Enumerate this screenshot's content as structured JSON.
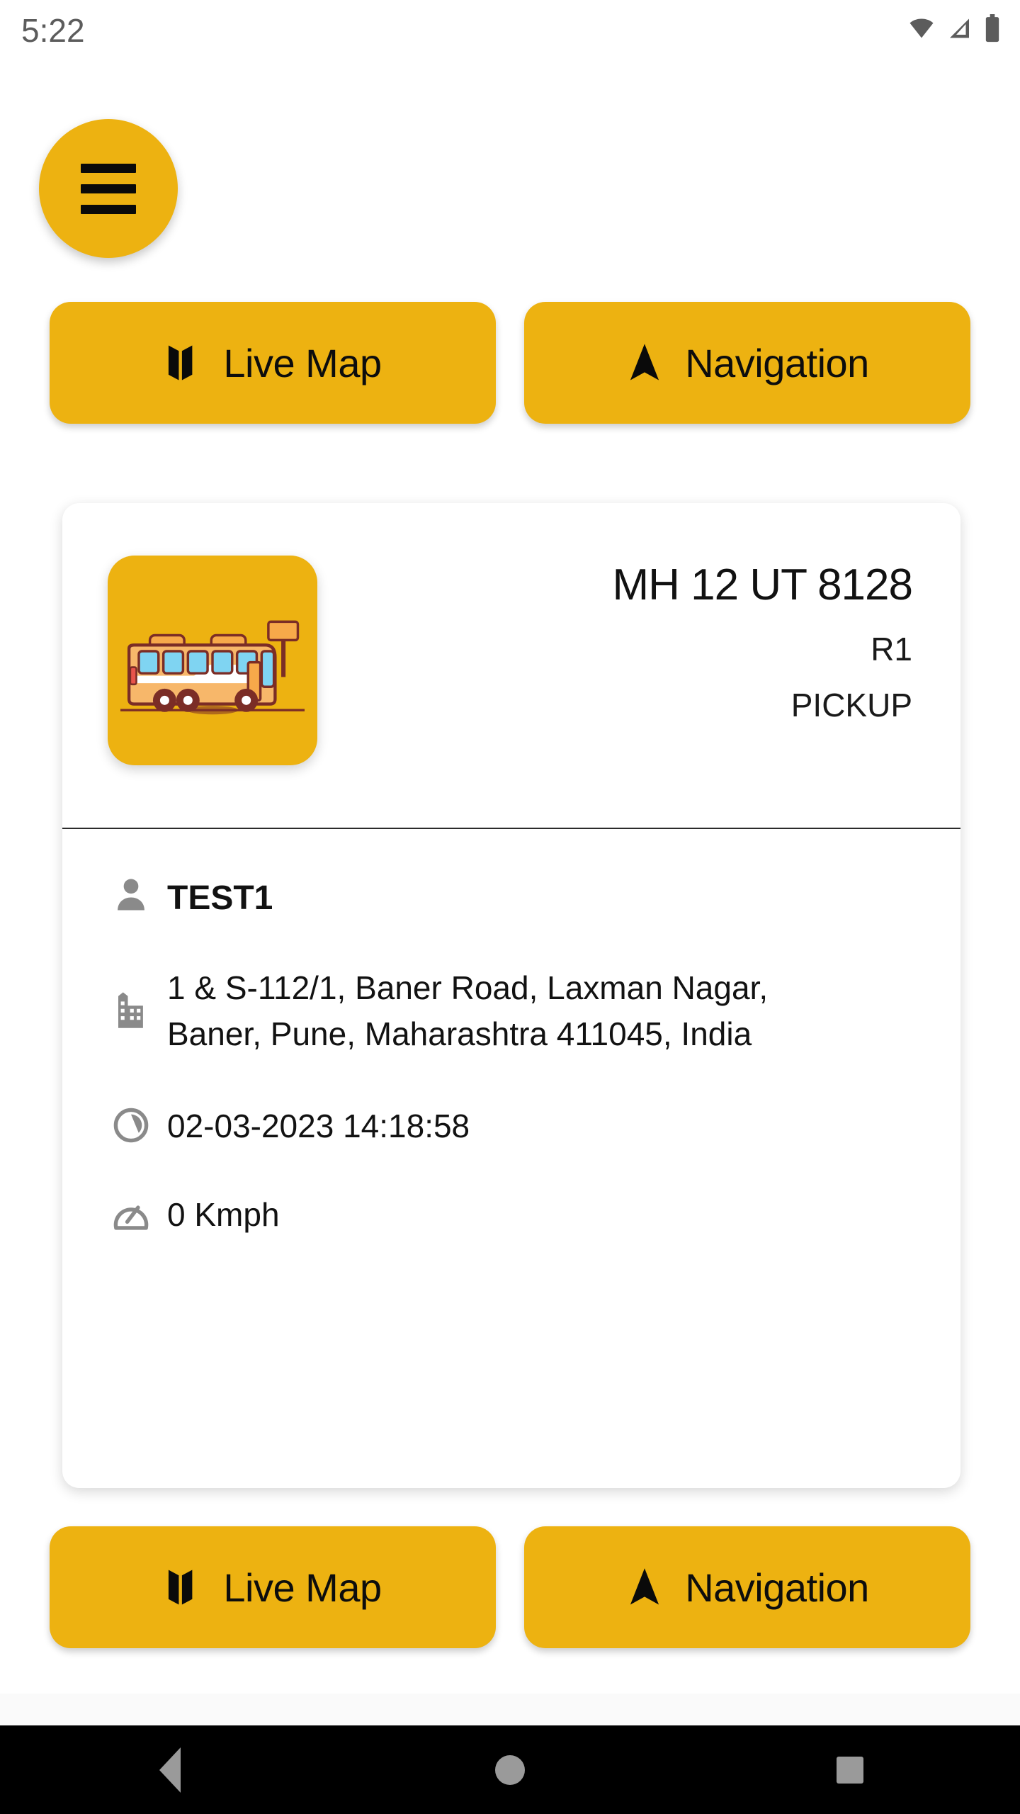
{
  "status_bar": {
    "time": "5:22",
    "icons": [
      "wifi-icon",
      "signal-icon",
      "battery-icon"
    ]
  },
  "menu_fab": {
    "name": "hamburger-menu-button",
    "icon": "hamburger-icon"
  },
  "theme": {
    "accent": "#EDB211",
    "card_bg": "#FFFFFF",
    "page_bg": "#FFFFFF",
    "text": "#121212",
    "icon_gray": "#8a8a8a",
    "navbar_bg": "#000000"
  },
  "top_actions": [
    {
      "label": "Live Map",
      "icon": "map-icon"
    },
    {
      "label": "Navigation",
      "icon": "navigation-arrow-icon"
    }
  ],
  "bottom_actions": [
    {
      "label": "Live Map",
      "icon": "map-icon"
    },
    {
      "label": "Navigation",
      "icon": "navigation-arrow-icon"
    }
  ],
  "vehicle_card": {
    "thumbnail_icon": "bus-icon",
    "plate": "MH 12 UT 8128",
    "route": "R1",
    "trip_type": "PICKUP",
    "details": [
      {
        "icon": "person-icon",
        "value": "TEST1"
      },
      {
        "icon": "building-icon",
        "value": "1 & S-112/1, Baner Road, Laxman Nagar, Baner, Pune, Maharashtra 411045, India"
      },
      {
        "icon": "clock-icon",
        "value": "02-03-2023 14:18:58"
      },
      {
        "icon": "speedometer-icon",
        "value": "0 Kmph"
      }
    ]
  },
  "system_nav": {
    "back": "back-button",
    "home": "home-button",
    "recents": "recents-button"
  }
}
